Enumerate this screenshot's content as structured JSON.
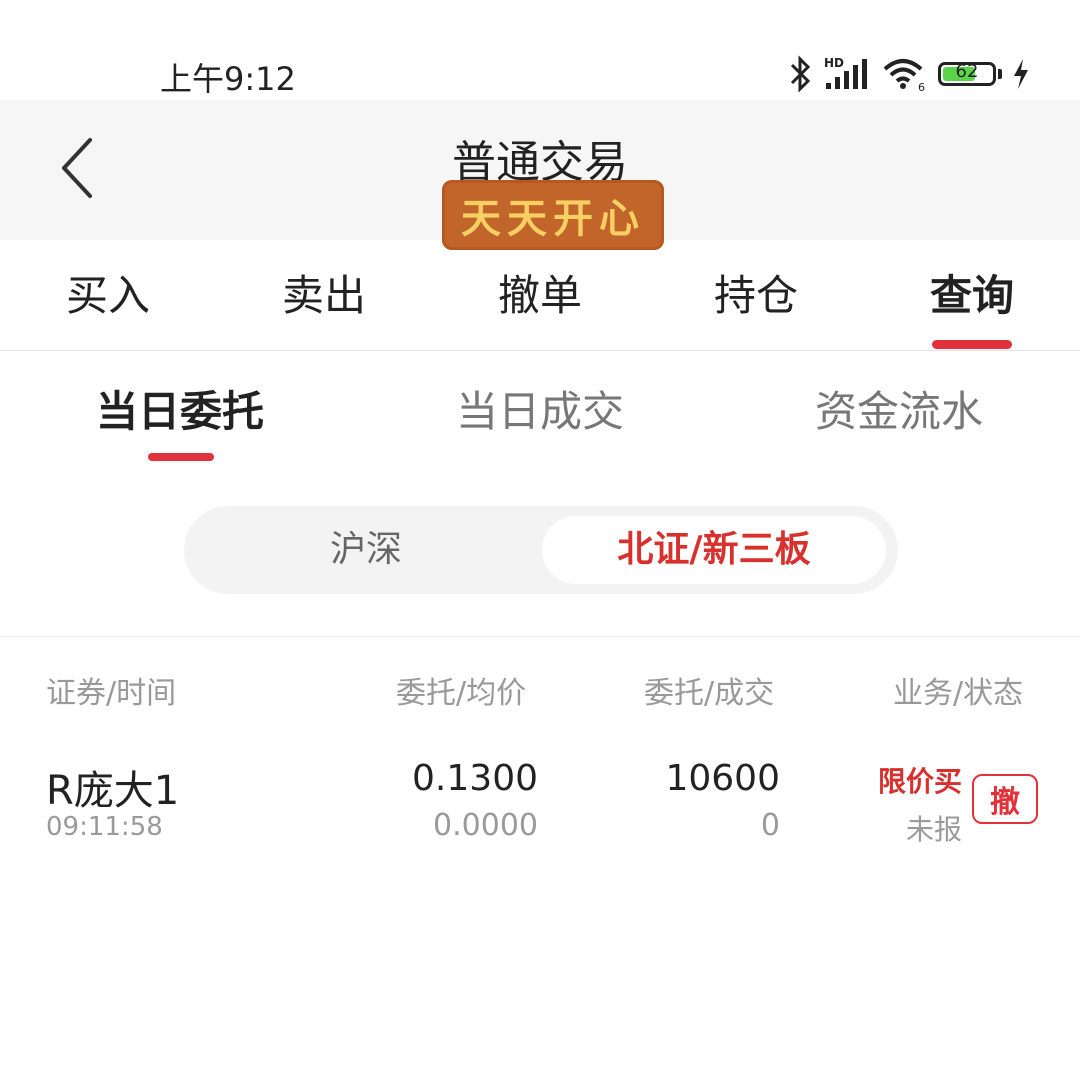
{
  "status_bar": {
    "time": "上午9:12",
    "battery_level": "62",
    "icons": [
      "bluetooth-icon",
      "hd-signal-icon",
      "wifi-icon",
      "battery-icon",
      "charging-icon"
    ]
  },
  "header": {
    "back_icon": "chevron-left-icon",
    "title": "普通交易",
    "sticker_text": "天天开心"
  },
  "main_tabs": [
    {
      "label": "买入"
    },
    {
      "label": "卖出"
    },
    {
      "label": "撤单"
    },
    {
      "label": "持仓"
    },
    {
      "label": "查询",
      "active": true
    }
  ],
  "sub_tabs": [
    {
      "label": "当日委托",
      "active": true
    },
    {
      "label": "当日成交"
    },
    {
      "label": "资金流水"
    }
  ],
  "market_segment": {
    "left": "沪深",
    "right": "北证/新三板",
    "selected": "北证/新三板"
  },
  "table": {
    "headers": [
      "证券/时间",
      "委托/均价",
      "委托/成交",
      "业务/状态"
    ],
    "rows": [
      {
        "name": "R庞大1",
        "time": "09:11:58",
        "order_price": "0.1300",
        "avg_price": "0.0000",
        "order_qty": "10600",
        "filled_qty": "0",
        "business": "限价买",
        "status": "未报",
        "action": "撤"
      }
    ]
  },
  "colors": {
    "accent": "#e0323d",
    "sticker_bg": "#c1652a",
    "sticker_text": "#f7cf63"
  }
}
